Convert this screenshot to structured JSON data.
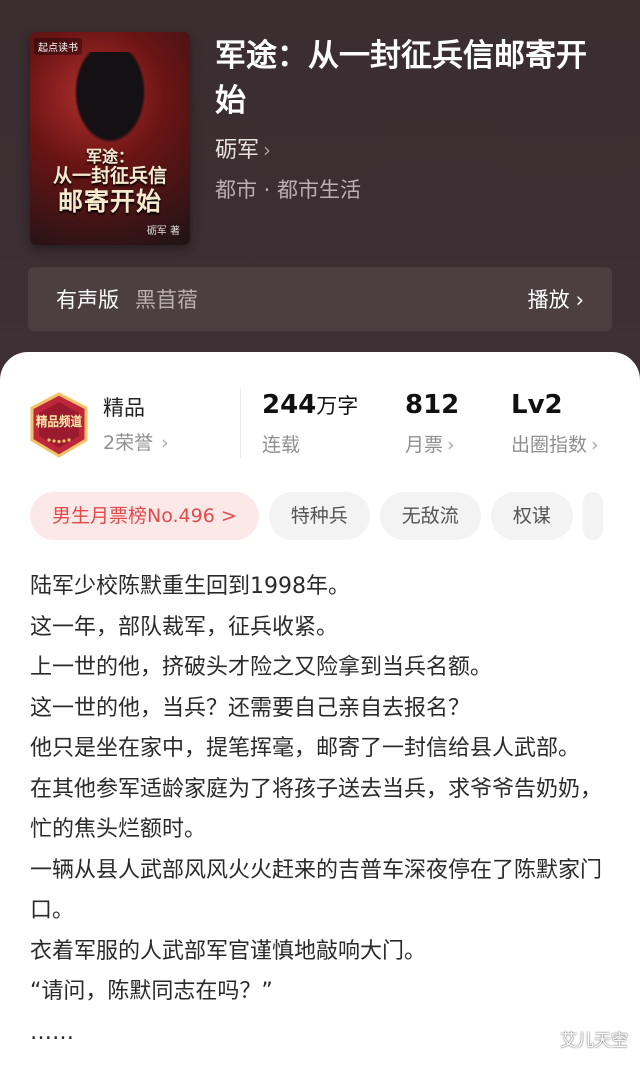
{
  "book": {
    "title": "军途：从一封征兵信邮寄开始",
    "author": "砺军",
    "genre": "都市 · 都市生活"
  },
  "cover": {
    "publisher_badge": "起点读书",
    "title_line1": "军途：",
    "title_line2": "从一封征兵信",
    "title_line3": "邮寄开始",
    "author_credit": "砺军 著"
  },
  "audio": {
    "label": "有声版",
    "narrator": "黑苜蓿",
    "play_label": "播放"
  },
  "stats": {
    "quality": "精品",
    "honor": "2荣誉",
    "badge_text": "精品频道",
    "words_value": "244",
    "words_unit": "万字",
    "status": "连载",
    "monthly_votes": "812",
    "monthly_votes_label": "月票",
    "level": "Lv2",
    "level_label": "出圈指数"
  },
  "tags": [
    "男生月票榜No.496 >",
    "特种兵",
    "无敌流",
    "权谋"
  ],
  "description": [
    "陆军少校陈默重生回到1998年。",
    "这一年，部队裁军，征兵收紧。",
    "上一世的他，挤破头才险之又险拿到当兵名额。",
    "这一世的他，当兵？还需要自己亲自去报名？",
    "他只是坐在家中，提笔挥毫，邮寄了一封信给县人武部。",
    "在其他参军适龄家庭为了将孩子送去当兵，求爷爷告奶奶，忙的焦头烂额时。",
    "一辆从县人武部风风火火赶来的吉普车深夜停在了陈默家门口。",
    "衣着军服的人武部军官谨慎地敲响大门。",
    "“请问，陈默同志在吗？”",
    "……"
  ],
  "watermark": "艾儿天空",
  "colors": {
    "accent_red": "#e04a4a",
    "hero_bg": "#3c2f33"
  }
}
